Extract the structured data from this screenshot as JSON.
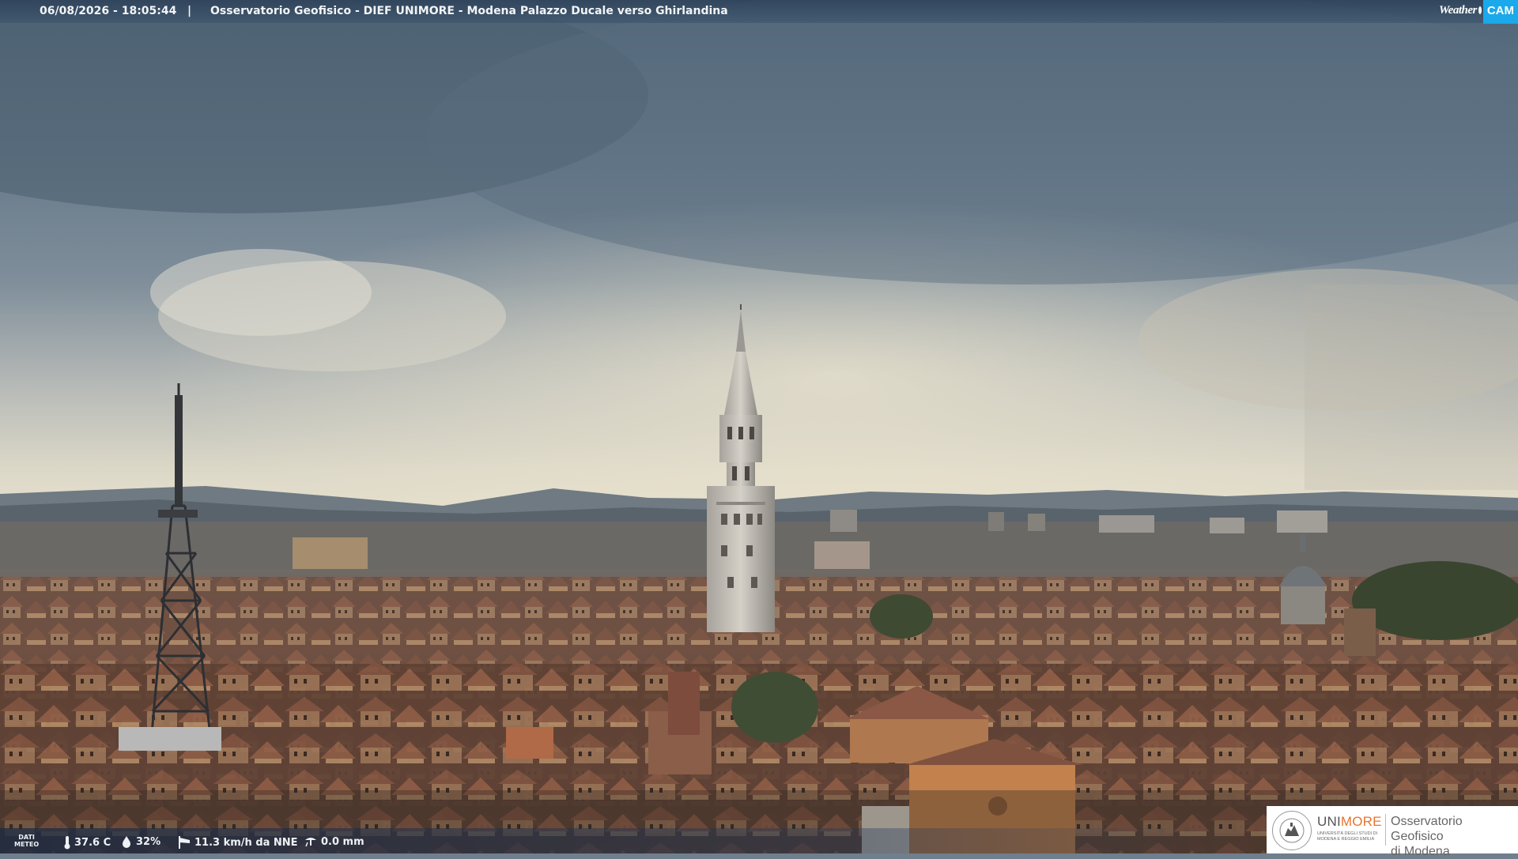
{
  "header": {
    "timestamp": "06/08/2026 - 18:05:44",
    "separator": "|",
    "title": "Osservatorio Geofisico - DIEF UNIMORE - Modena Palazzo Ducale verso Ghirlandina"
  },
  "logo_weathercam": {
    "weather_text": "Weather",
    "cam_text": "CAM",
    "accent_color": "#1aa9ea"
  },
  "meteo": {
    "label_line1": "DATI",
    "label_line2": "METEO",
    "temperature": "37.6 C",
    "humidity": "32%",
    "wind": "11.3 km/h da NNE",
    "rain": "0.0 mm",
    "icons": [
      "thermometer-icon",
      "humidity-drop-icon",
      "wind-sock-icon",
      "rain-gauge-icon"
    ]
  },
  "institution": {
    "brand_uni": "UNI",
    "brand_more": "MORE",
    "brand_sub": "UNIVERSITÀ DEGLI STUDI DI MODENA E REGGIO EMILIA",
    "observatory_line1": "Osservatorio Geofisico",
    "observatory_line2": "di Modena",
    "brand_color": "#e8752c"
  }
}
